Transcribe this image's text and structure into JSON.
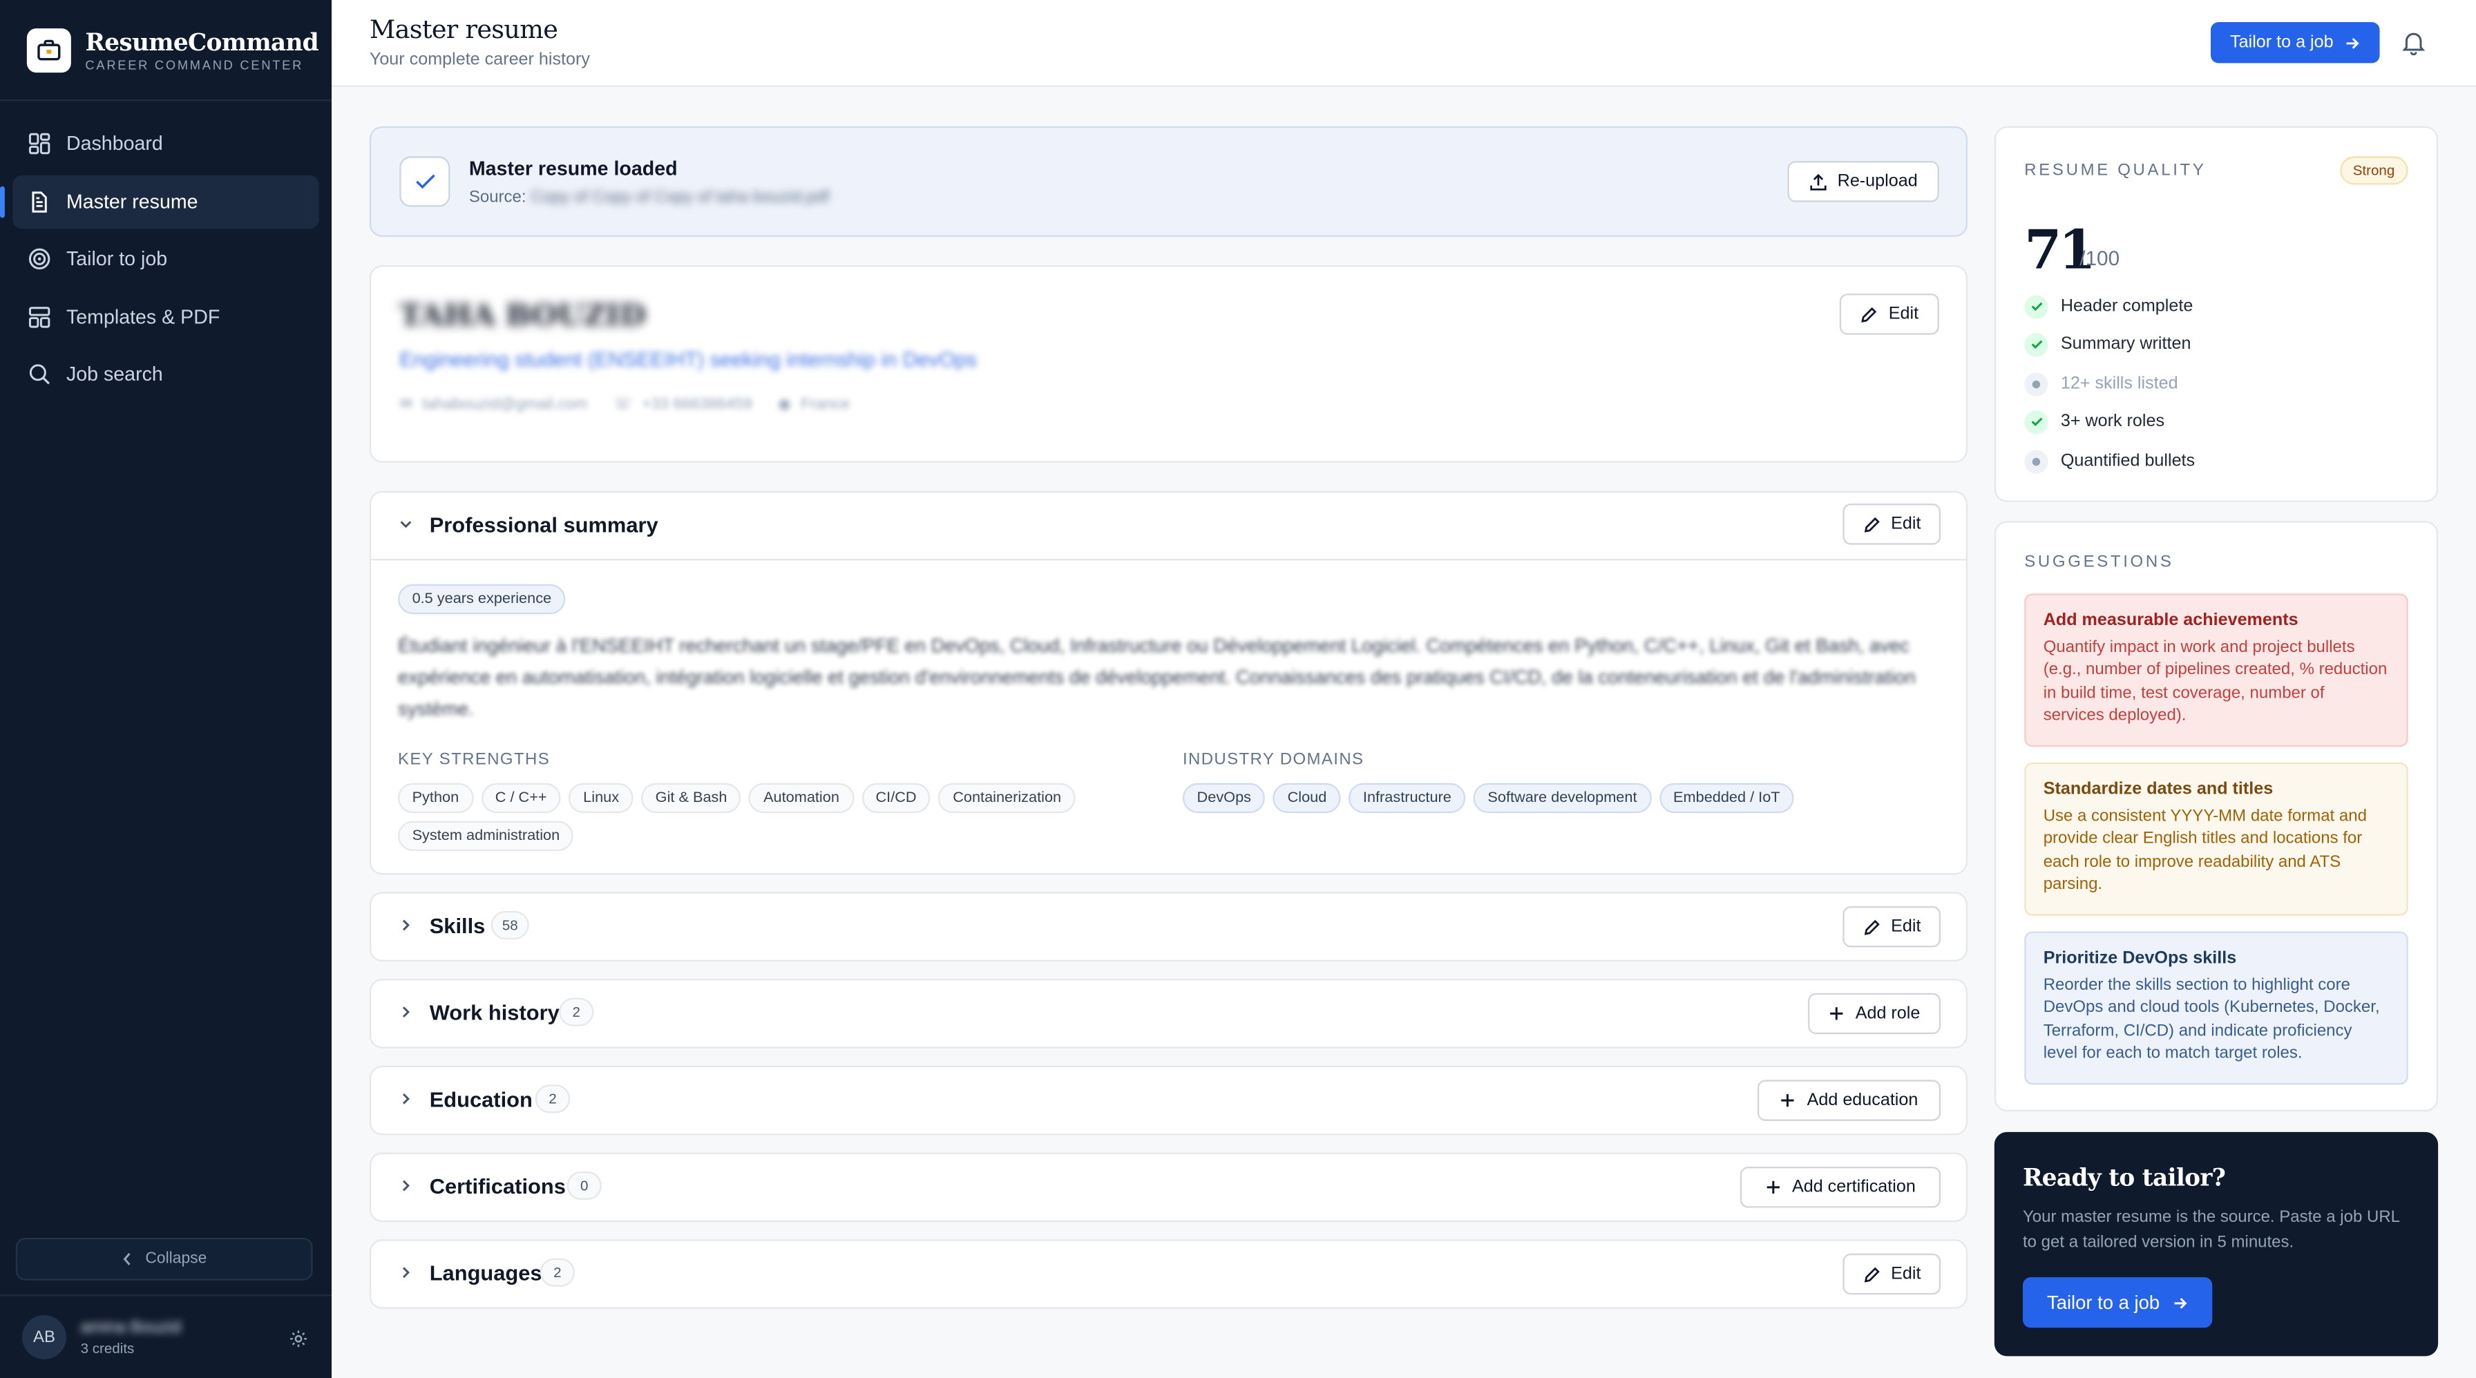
{
  "brand": {
    "name": "ResumeCommand",
    "subtitle": "CAREER COMMAND CENTER"
  },
  "nav": [
    {
      "label": "Dashboard",
      "icon": "dashboard-icon"
    },
    {
      "label": "Master resume",
      "icon": "document-icon",
      "active": true
    },
    {
      "label": "Tailor to job",
      "icon": "target-icon"
    },
    {
      "label": "Templates & PDF",
      "icon": "templates-icon"
    },
    {
      "label": "Job search",
      "icon": "search-icon"
    }
  ],
  "sidebar": {
    "collapse_label": "Collapse"
  },
  "user": {
    "initials": "AB",
    "name": "amina Bouzid",
    "credits": "3 credits"
  },
  "header": {
    "title": "Master resume",
    "subtitle": "Your complete career history",
    "tailor_label": "Tailor to a job"
  },
  "loaded": {
    "title": "Master resume loaded",
    "source_label": "Source:",
    "source_file": "Copy of Copy of Copy of taha bouzid.pdf",
    "reupload_label": "Re-upload"
  },
  "profile": {
    "name": "TAHA BOUZID",
    "headline": "Engineering student (ENSEEIHT) seeking internship in DevOps",
    "email": "tahabouzid@gmail.com",
    "phone": "+33 666386459",
    "location": "France",
    "edit_label": "Edit"
  },
  "summary": {
    "title": "Professional summary",
    "edit_label": "Edit",
    "experience": "0.5 years experience",
    "text": "Étudiant ingénieur à l'ENSEEIHT recherchant un stage/PFE en DevOps, Cloud, Infrastructure ou Développement Logiciel. Compétences en Python, C/C++, Linux, Git et Bash, avec expérience en automatisation, intégration logicielle et gestion d'environnements de développement. Connaissances des pratiques CI/CD, de la conteneurisation et de l'administration système.",
    "strengths_label": "KEY STRENGTHS",
    "strengths": [
      "Python",
      "C / C++",
      "Linux",
      "Git & Bash",
      "Automation",
      "CI/CD",
      "Containerization",
      "System administration"
    ],
    "domains_label": "INDUSTRY DOMAINS",
    "domains": [
      "DevOps",
      "Cloud",
      "Infrastructure",
      "Software development",
      "Embedded / IoT"
    ]
  },
  "sections": [
    {
      "title": "Skills",
      "count": "58",
      "action": "Edit"
    },
    {
      "title": "Work history",
      "count": "2",
      "action": "Add role"
    },
    {
      "title": "Education",
      "count": "2",
      "action": "Add education"
    },
    {
      "title": "Certifications",
      "count": "0",
      "action": "Add certification"
    },
    {
      "title": "Languages",
      "count": "2",
      "action": "Edit"
    }
  ],
  "quality": {
    "label": "RESUME QUALITY",
    "badge": "Strong",
    "score": "71",
    "max": "/100",
    "items": [
      {
        "label": "Header complete",
        "done": true
      },
      {
        "label": "Summary written",
        "done": true
      },
      {
        "label": "12+ skills listed",
        "done": false
      },
      {
        "label": "3+ work roles",
        "done": true
      },
      {
        "label": "Quantified bullets",
        "done": false
      }
    ]
  },
  "suggestions": {
    "label": "SUGGESTIONS",
    "items": [
      {
        "title": "Add measurable achievements",
        "body": "Quantify impact in work and project bullets (e.g., number of pipelines created, % reduction in build time, test coverage, number of services deployed).",
        "tone": "red"
      },
      {
        "title": "Standardize dates and titles",
        "body": "Use a consistent YYYY-MM date format and provide clear English titles and locations for each role to improve readability and ATS parsing.",
        "tone": "amber"
      },
      {
        "title": "Prioritize DevOps skills",
        "body": "Reorder the skills section to highlight core DevOps and cloud tools (Kubernetes, Docker, Terraform, CI/CD) and indicate proficiency level for each to match target roles.",
        "tone": "blue"
      }
    ]
  },
  "ready": {
    "title": "Ready to tailor?",
    "body": "Your master resume is the source. Paste a job URL to get a tailored version in 5 minutes.",
    "button_label": "Tailor to a job"
  }
}
